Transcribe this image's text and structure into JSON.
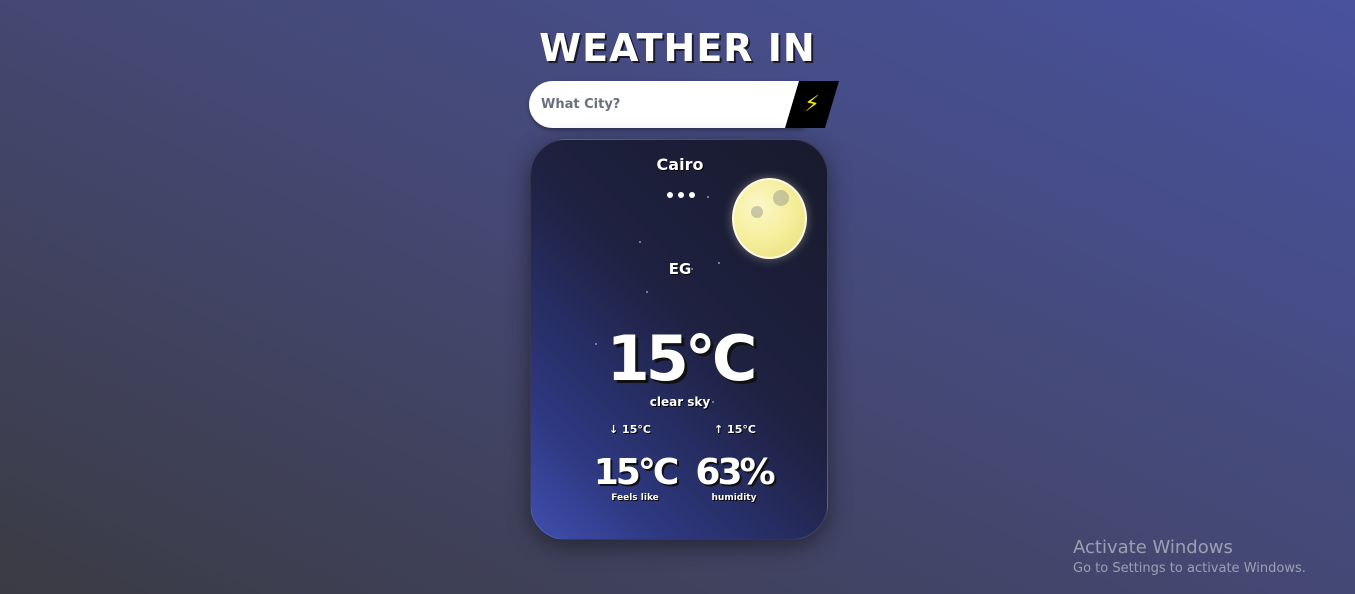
{
  "header": {
    "title": "WEATHER IN"
  },
  "search": {
    "placeholder": "What City?",
    "button_icon": "lightning-bolt-icon",
    "button_glyph": "⚡"
  },
  "card": {
    "city": "Cairo",
    "country": "EG",
    "weather_icon": "moon-icon",
    "temperature": "15°C",
    "description": "clear sky",
    "temp_min": "↓ 15°C",
    "temp_max": "↑ 15°C",
    "feels_like": {
      "value": "15°C",
      "label": "Feels like"
    },
    "humidity": {
      "value": "63%",
      "label": "humidity"
    }
  },
  "watermark": {
    "line1": "Activate Windows",
    "line2": "Go to Settings to activate Windows."
  },
  "colors": {
    "accent_button": "#000000",
    "bolt": "#f1e800",
    "moon": "#f6ef9e"
  }
}
